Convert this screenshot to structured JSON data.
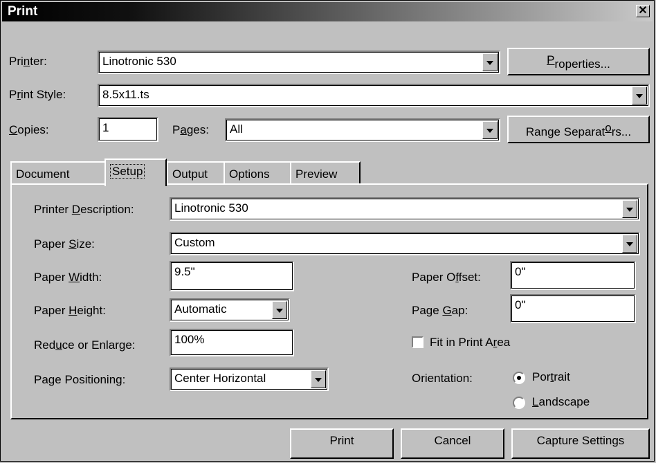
{
  "window": {
    "title": "Print"
  },
  "printer": {
    "label_pre": "Pri",
    "label_u": "n",
    "label_post": "ter:",
    "value": "Linotronic 530"
  },
  "properties_button": {
    "u": "P",
    "rest": "roperties..."
  },
  "print_style": {
    "label_pre": "P",
    "label_u": "r",
    "label_post": "int Style:",
    "value": "8.5x11.ts"
  },
  "copies": {
    "label_u": "C",
    "label_post": "opies:",
    "value": "1"
  },
  "pages": {
    "label_pre": "P",
    "label_u": "a",
    "label_post": "ges:",
    "value": "All"
  },
  "range_button": {
    "pre": "Range Separat",
    "u": "o",
    "post": "rs..."
  },
  "tabs": [
    {
      "label": "Document"
    },
    {
      "label": "Setup"
    },
    {
      "label": "Output"
    },
    {
      "label": "Options"
    },
    {
      "label": "Preview"
    }
  ],
  "setup": {
    "printer_description": {
      "pre": "Printer ",
      "u": "D",
      "post": "escription:",
      "value": "Linotronic 530"
    },
    "paper_size": {
      "pre": "Paper ",
      "u": "S",
      "post": "ize:",
      "value": "Custom"
    },
    "paper_width": {
      "pre": "Paper ",
      "u": "W",
      "post": "idth:",
      "value": "9.5\""
    },
    "paper_height": {
      "pre": "Paper ",
      "u": "H",
      "post": "eight:",
      "value": "Automatic"
    },
    "reduce_enlarge": {
      "pre": "Red",
      "u": "u",
      "post": "ce or Enlarge:",
      "value": "100%"
    },
    "page_positioning": {
      "pre": "Pa",
      "u": "g",
      "post": "e Positioning:",
      "value": "Center Horizontal"
    },
    "paper_offset": {
      "pre": "Paper O",
      "u": "f",
      "post": "fset:",
      "value": "0\""
    },
    "page_gap": {
      "pre": "Page ",
      "u": "G",
      "post": "ap:",
      "value": "0\""
    },
    "fit_in_print_area": {
      "pre": "Fit in Print A",
      "u": "r",
      "post": "ea",
      "checked": false
    },
    "orientation": {
      "label": "Orientation:",
      "portrait_pre": "Por",
      "portrait_u": "t",
      "portrait_post": "rait",
      "landscape_u": "L",
      "landscape_post": "andscape",
      "selected": "portrait"
    }
  },
  "buttons": {
    "print": "Print",
    "cancel": "Cancel",
    "capture": "Capture Settings"
  }
}
